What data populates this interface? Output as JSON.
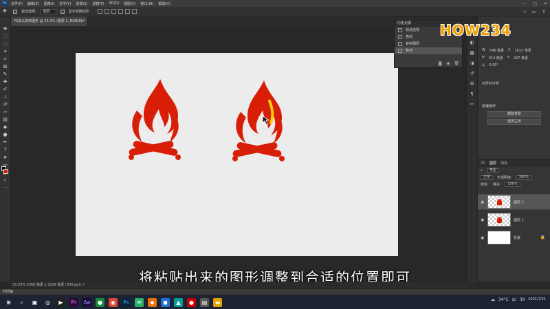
{
  "menu": {
    "logo": "Ps",
    "items": [
      "文件(F)",
      "编辑(E)",
      "图像(I)",
      "文字(Y)",
      "选择(S)",
      "滤镜(T)",
      "3D(D)",
      "视图(V)",
      "窗口(W)",
      "帮助(H)"
    ],
    "window_controls": [
      "—",
      "□",
      "✕"
    ]
  },
  "options_bar": {
    "auto_select_label": "自动选择:",
    "auto_select_value": "图层",
    "show_transform_label": "显示变换控件"
  },
  "document": {
    "tab_title": "PS怎么复制图形 @ 33.3% (图层 2, RGB/8) *",
    "close": "×",
    "status": "33.33%   3366 像素 x 2126 像素 (300 ppi)   >"
  },
  "history": {
    "title": "历史记录",
    "items": [
      "取消选择",
      "移动",
      "复制图层",
      "移动"
    ],
    "active_index": 3
  },
  "properties": {
    "w_label": "W",
    "w_value": "546 像素",
    "x_label": "X",
    "x_value": "1632 像素",
    "h_label": "H",
    "h_value": "914 像素",
    "y_label": "Y",
    "y_value": "297 像素",
    "angle": "0.00°",
    "align_section": "对齐并分布",
    "quick_actions_section": "快速操作",
    "quick_actions": [
      "删除背景",
      "选择主体"
    ]
  },
  "layers": {
    "tabs": [
      "3D",
      "图层",
      "通道"
    ],
    "active_tab": 1,
    "filter_label": "类型",
    "blend_mode": "正常",
    "opacity_label": "不透明度:",
    "opacity_value": "100%",
    "lock_label": "锁定:",
    "fill_label": "填充:",
    "fill_value": "100%",
    "items": [
      {
        "name": "图层 2",
        "selected": true
      },
      {
        "name": "图层 1",
        "selected": false
      },
      {
        "name": "背景",
        "selected": false
      }
    ]
  },
  "watermark": "HOW234",
  "subtitle": "将粘贴出来的图形调整到合适的位置即可",
  "timeline_label": "时间轴",
  "tray": {
    "weather": "34°C",
    "input": "中",
    "clock_time": "",
    "date": "2021/7/21",
    "count": "39"
  },
  "colors": {
    "flame": "#d81e06",
    "canvas_bg": "#ececec",
    "workspace": "#282828",
    "watermark": "#f0a000"
  }
}
